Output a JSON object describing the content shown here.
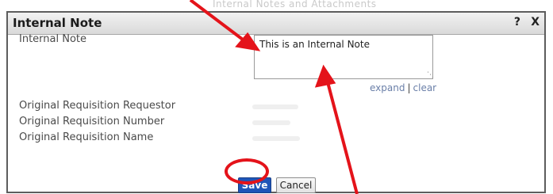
{
  "background": {
    "faded_text": "Internal Notes and Attachments"
  },
  "dialog": {
    "title": "Internal Note",
    "help_label": "?",
    "close_label": "X"
  },
  "form": {
    "note_label": "Internal Note",
    "note_value": "This is an Internal Note",
    "expand_label": "expand",
    "separator": "|",
    "clear_label": "clear",
    "fields": [
      {
        "label": "Original Requisition Requestor"
      },
      {
        "label": "Original Requisition Number"
      },
      {
        "label": "Original Requisition Name"
      }
    ]
  },
  "buttons": {
    "save_label": "Save",
    "cancel_label": "Cancel"
  },
  "annotation": {
    "color": "#e4131a"
  }
}
